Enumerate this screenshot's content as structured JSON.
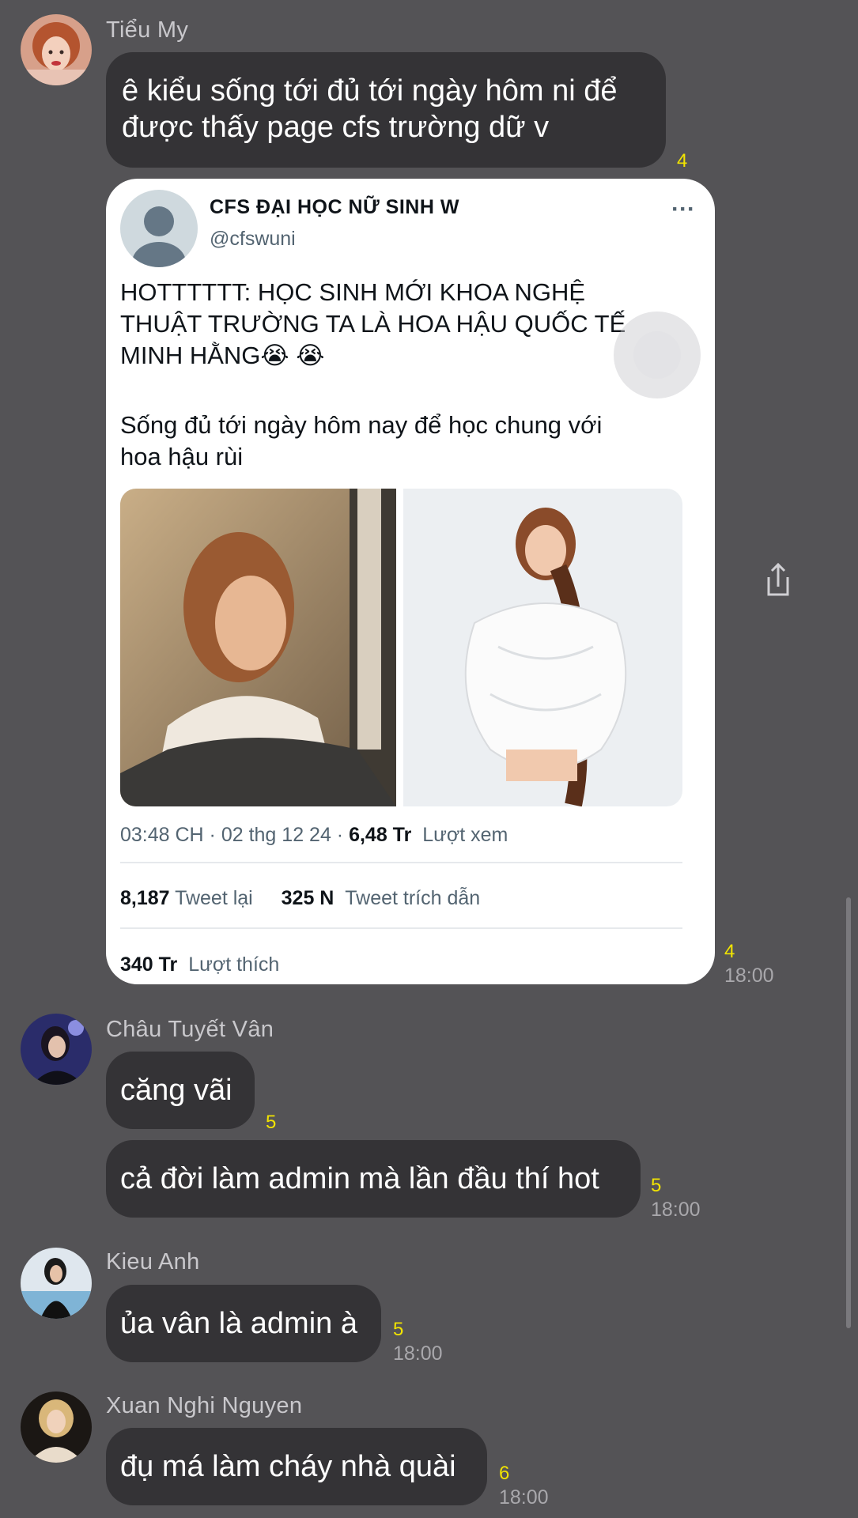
{
  "messages": [
    {
      "sender": "Tiểu My",
      "text": "ê kiểu sống tới đủ tới ngày hôm ni để được thấy page cfs trường dữ v",
      "read_count": "4"
    },
    {
      "type": "tweet",
      "tweet": {
        "name": "CFS ĐẠI HỌC NỮ SINH W",
        "handle": "@cfswuni",
        "more_icon": "···",
        "headline_line1": "HOTTTTTT: HỌC SINH MỚI KHOA NGHỆ",
        "headline_line2": "THUẬT TRƯỜNG TA LÀ HOA HẬU QUỐC TẾ",
        "headline_line3": "MINH HẰNG😭 😭",
        "body_line1": "Sống đủ tới ngày hôm nay để học chung với",
        "body_line2": "hoa hậu rùi",
        "meta_time": "03:48 CH · 02 thg 12 24 ·",
        "views_count": "6,48 Tr",
        "views_label": "Lượt xem",
        "retweets_count": "8,187",
        "retweets_label": "Tweet lại",
        "quotes_count": "325 N",
        "quotes_label": "Tweet trích dẫn",
        "likes_count": "340 Tr",
        "likes_label": "Lượt thích"
      },
      "read_count": "4",
      "time": "18:00"
    },
    {
      "sender": "Châu Tuyết Vân",
      "text": "căng vãi",
      "read_count": "5"
    },
    {
      "text": "cả đời làm admin mà lần đầu thí hot",
      "read_count": "5",
      "time": "18:00"
    },
    {
      "sender": "Kieu Anh",
      "text": "ủa vân là admin à",
      "read_count": "5",
      "time": "18:00"
    },
    {
      "sender": "Xuan Nghi Nguyen",
      "text": "đụ má làm cháy nhà quài",
      "read_count": "6",
      "time": "18:00"
    }
  ],
  "icons": {
    "share": "share-icon",
    "more": "more-icon"
  },
  "colors": {
    "background": "#545356",
    "bubble": "#343336",
    "read_count": "#f2e400",
    "sender": "#c9c8cc",
    "time": "#a9a8ac"
  }
}
